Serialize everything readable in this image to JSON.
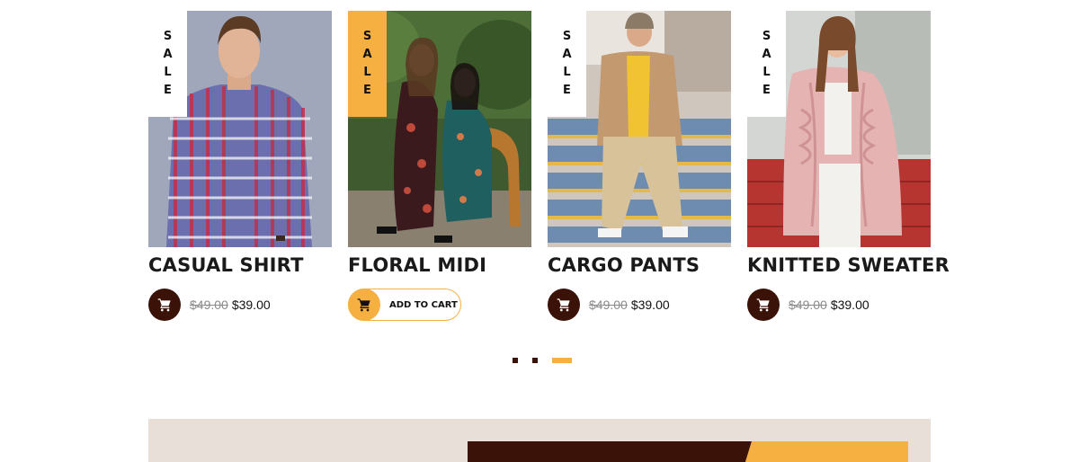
{
  "products": [
    {
      "title": "CASUAL SHIRT",
      "badge": "SALE",
      "old_price": "$49.00",
      "new_price": "$39.00",
      "icon": "cart-icon"
    },
    {
      "title": "FLORAL MIDI",
      "badge": "SALE",
      "cart_label": "ADD TO CART",
      "icon": "cart-icon"
    },
    {
      "title": "CARGO PANTS",
      "badge": "SALE",
      "old_price": "$49.00",
      "new_price": "$39.00",
      "icon": "cart-icon"
    },
    {
      "title": "KNITTED SWEATER",
      "badge": "SALE",
      "old_price": "$49.00",
      "new_price": "$39.00",
      "icon": "cart-icon"
    }
  ],
  "pagination": {
    "count": 3,
    "active_index": 2
  },
  "colors": {
    "accent": "#f5b041",
    "dark": "#3a1208",
    "banner_bg": "#e8dfd8",
    "old_price": "#8a8a8a"
  }
}
